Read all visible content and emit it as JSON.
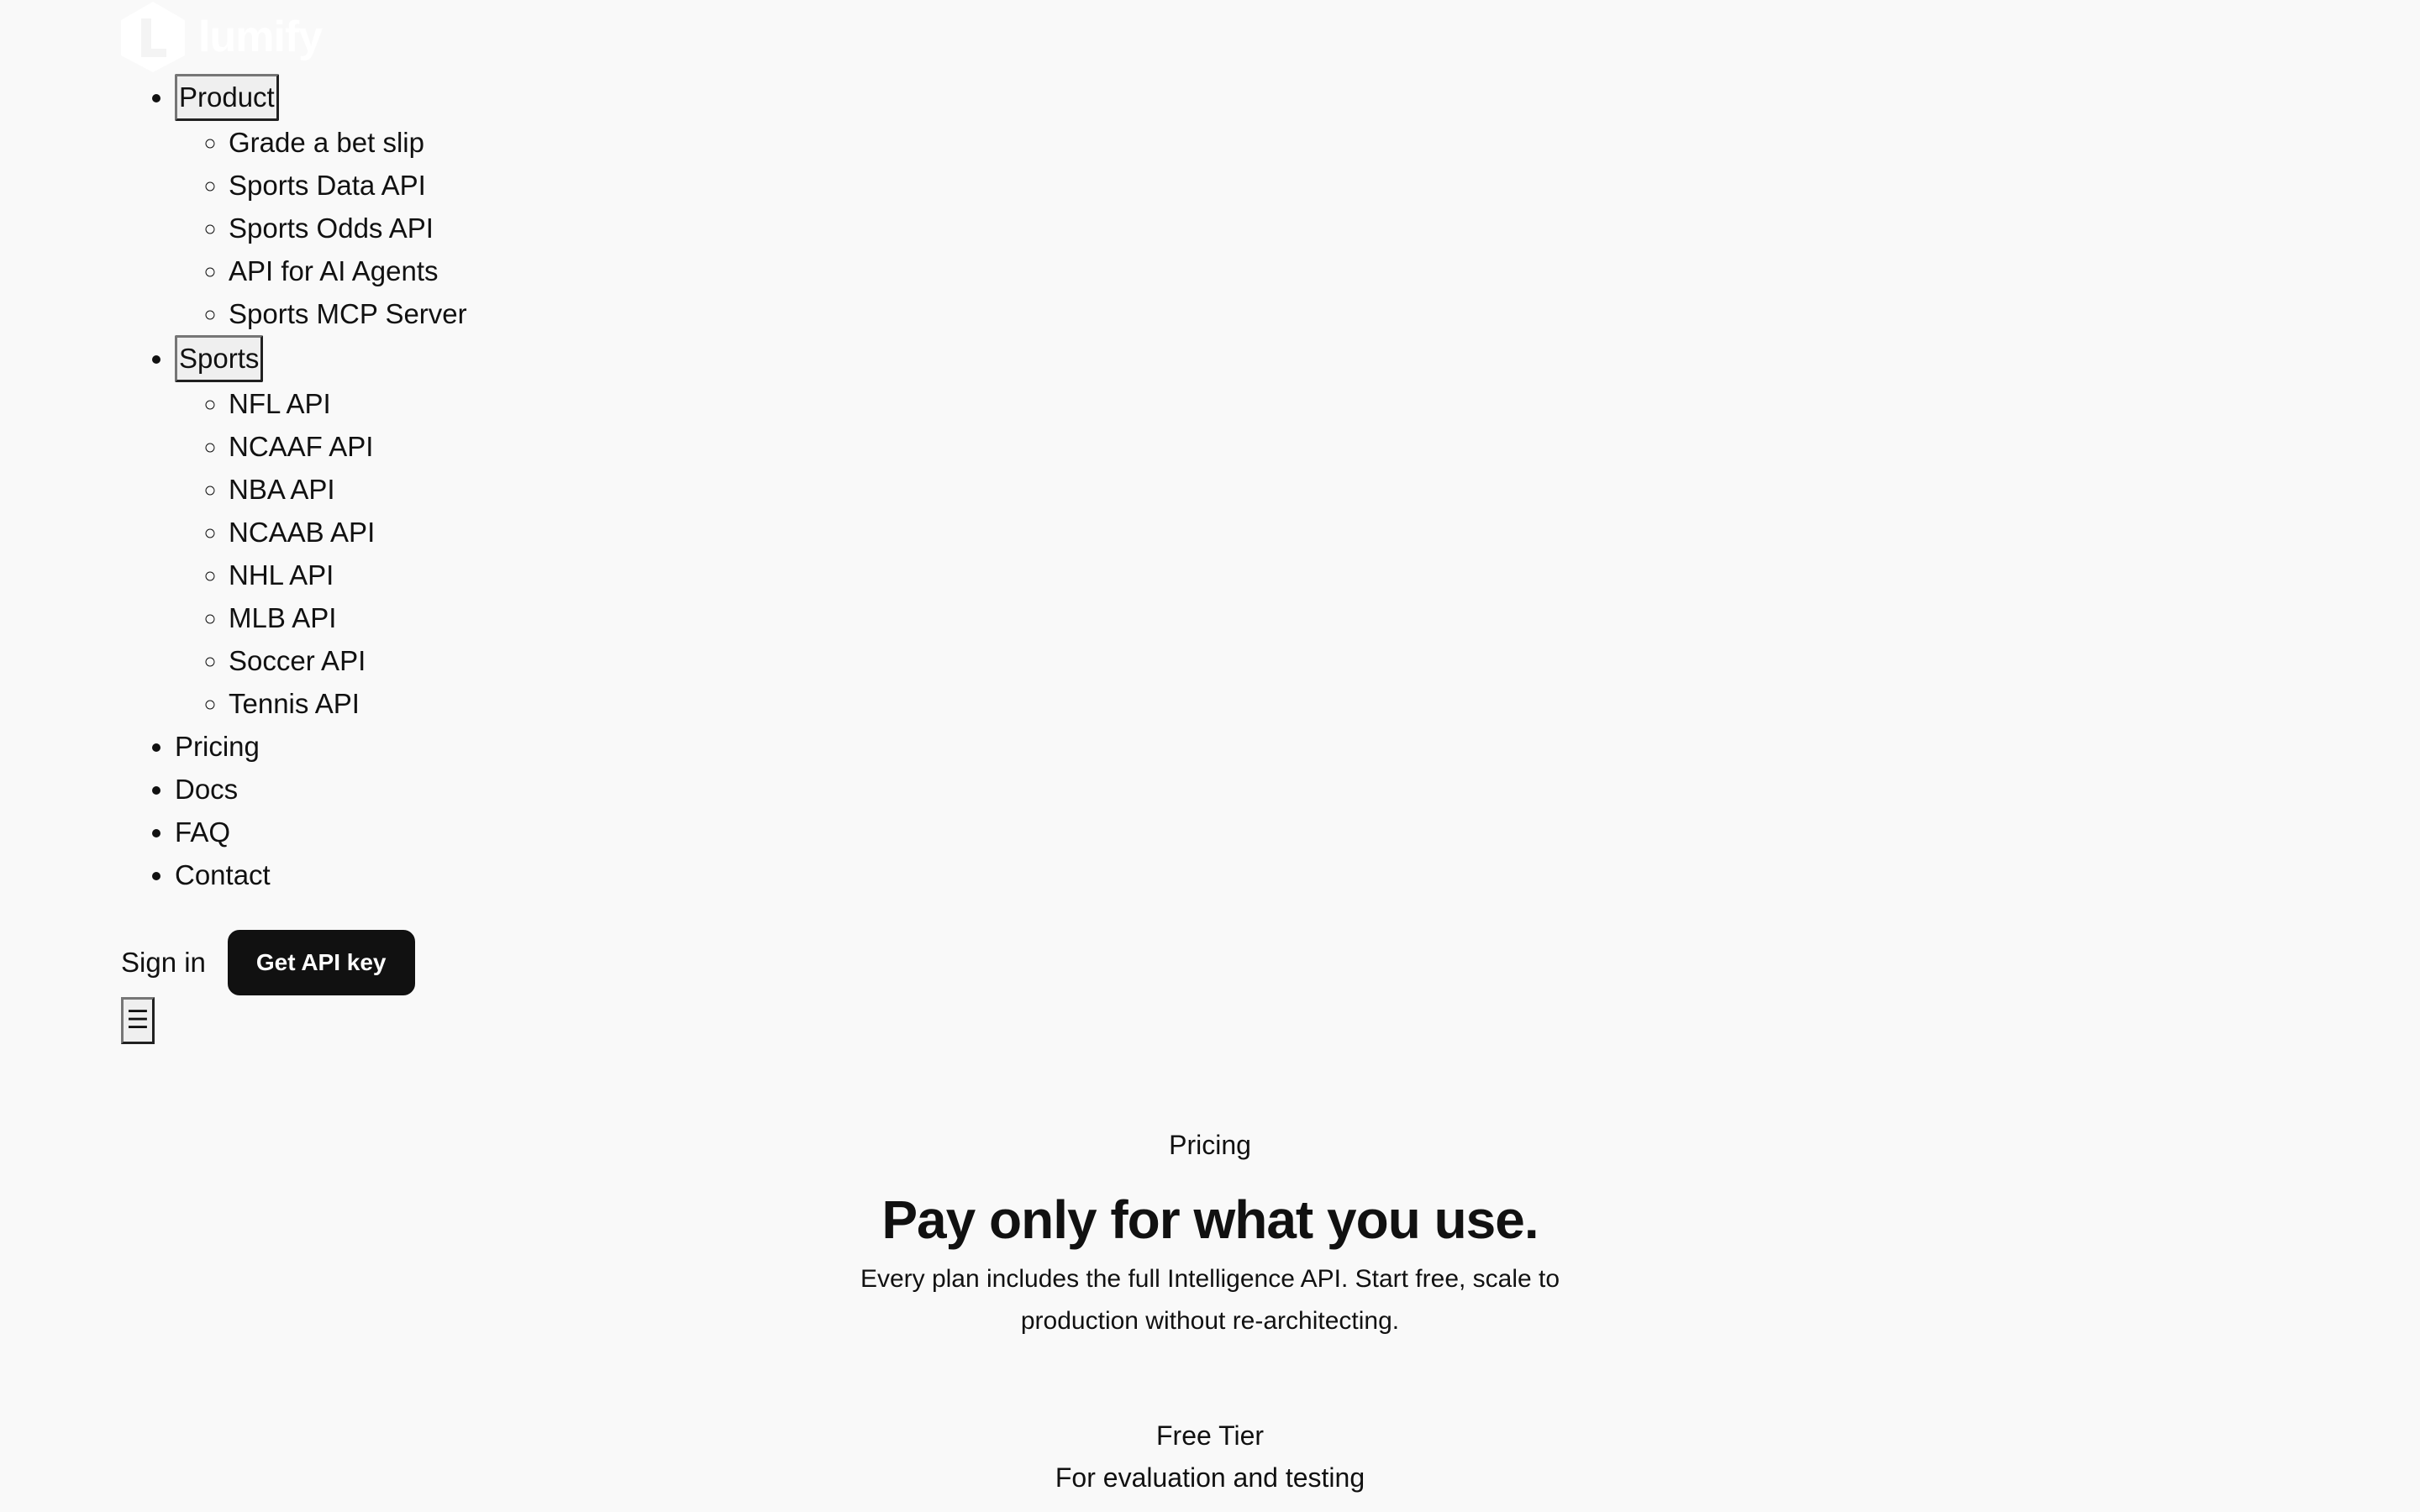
{
  "brand": {
    "name": "lumify",
    "logo_color": "#ffffff"
  },
  "nav": {
    "product": {
      "label": "Product",
      "items": [
        "Grade a bet slip",
        "Sports Data API",
        "Sports Odds API",
        "API for AI Agents",
        "Sports MCP Server"
      ]
    },
    "sports": {
      "label": "Sports",
      "items": [
        "NFL API",
        "NCAAF API",
        "NBA API",
        "NCAAB API",
        "NHL API",
        "MLB API",
        "Soccer API",
        "Tennis API"
      ]
    },
    "links": [
      "Pricing",
      "Docs",
      "FAQ",
      "Contact"
    ]
  },
  "actions": {
    "signin_label": "Sign in",
    "cta_label": "Get API key",
    "menu_icon": "hamburger-icon",
    "menu_glyph": "☰"
  },
  "hero": {
    "eyebrow": "Pricing",
    "headline": "Pay only for what you use.",
    "subtext": "Every plan includes the full Intelligence API. Start free, scale to production without re-architecting."
  },
  "plans": [
    {
      "name": "Free Tier",
      "description": "For evaluation and testing"
    }
  ],
  "colors": {
    "background": "#f9f9f9",
    "text": "#111111",
    "cta_background": "#111111",
    "cta_text": "#ffffff"
  }
}
